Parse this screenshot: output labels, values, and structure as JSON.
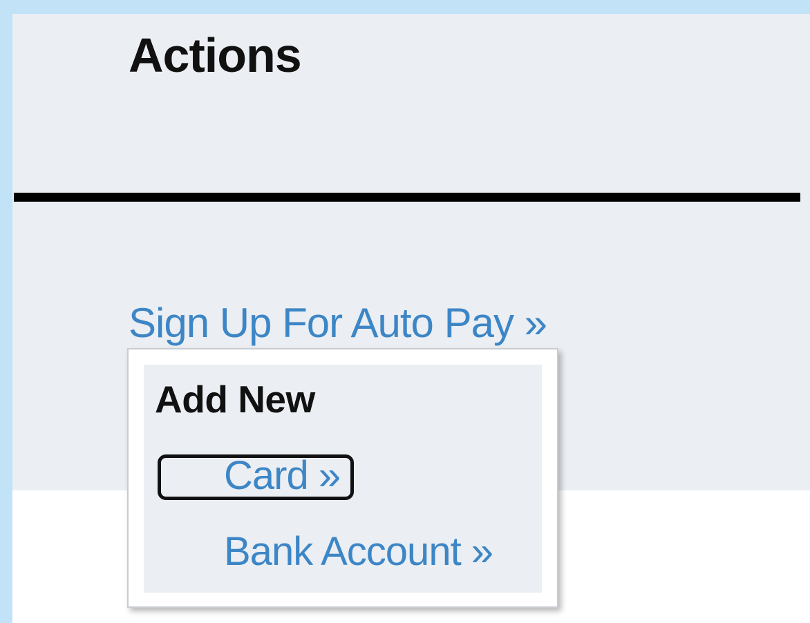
{
  "actions_panel": {
    "title": "Actions",
    "autopay_link": "Sign Up For Auto Pay »"
  },
  "add_new_menu": {
    "heading": "Add New",
    "items": [
      {
        "label": "Card »",
        "focused": true
      },
      {
        "label": "Bank Account »",
        "focused": false
      }
    ]
  },
  "colors": {
    "link": "#3d86c6",
    "panel_background": "#ebeef2",
    "outer_background": "#c2e2f7"
  }
}
